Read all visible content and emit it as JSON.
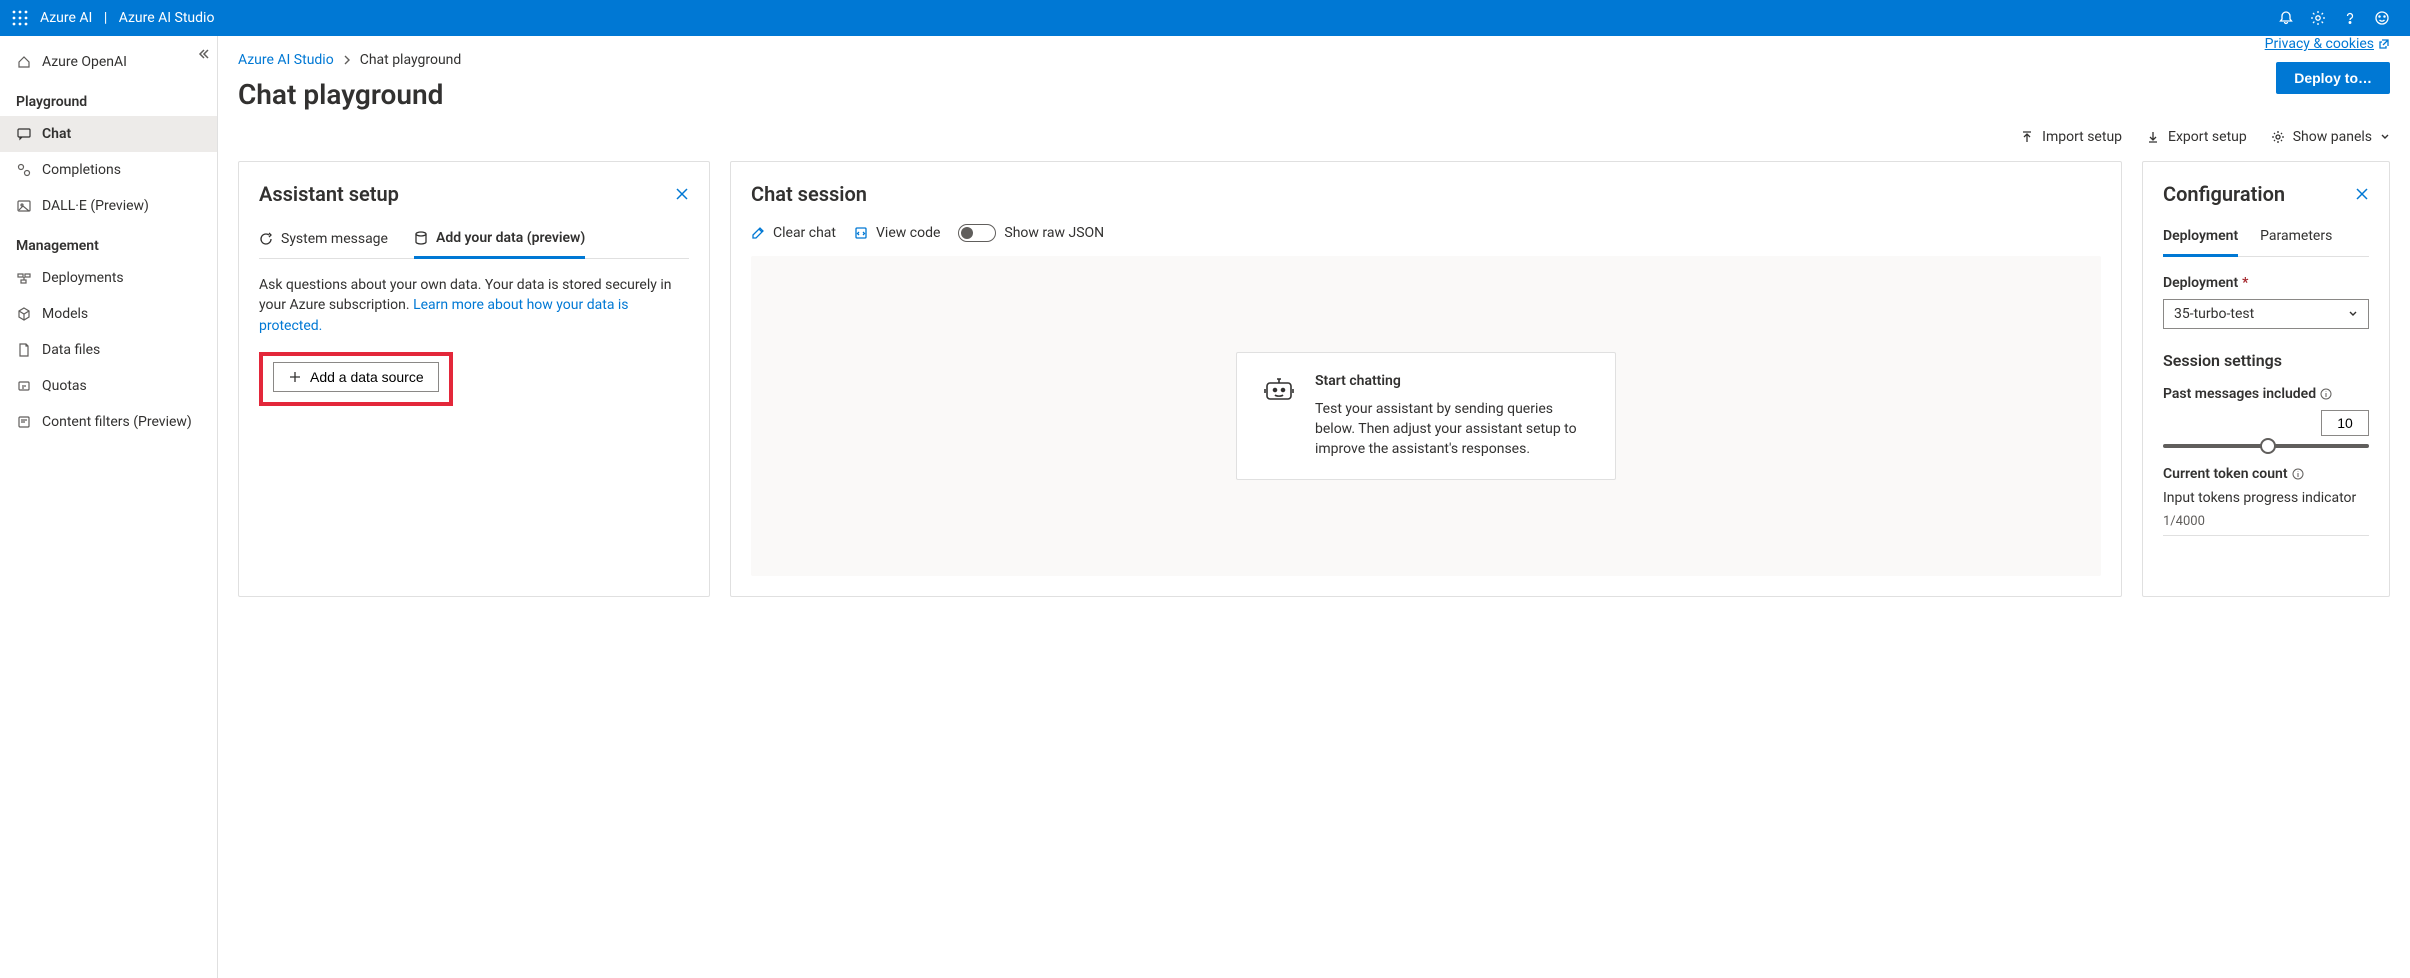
{
  "topbar": {
    "brand1": "Azure AI",
    "brand2": "Azure AI Studio"
  },
  "sidebar": {
    "items": [
      {
        "label": "Azure OpenAI"
      }
    ],
    "section_playground": "Playground",
    "playground_items": [
      {
        "label": "Chat"
      },
      {
        "label": "Completions"
      },
      {
        "label": "DALL·E (Preview)"
      }
    ],
    "section_management": "Management",
    "management_items": [
      {
        "label": "Deployments"
      },
      {
        "label": "Models"
      },
      {
        "label": "Data files"
      },
      {
        "label": "Quotas"
      },
      {
        "label": "Content filters (Preview)"
      }
    ]
  },
  "breadcrumb": {
    "root": "Azure AI Studio",
    "leaf": "Chat playground"
  },
  "page": {
    "title": "Chat playground",
    "privacy": "Privacy & cookies",
    "deploy": "Deploy to…",
    "import": "Import setup",
    "export": "Export setup",
    "show_panels": "Show panels"
  },
  "assistant": {
    "title": "Assistant setup",
    "tab_system": "System message",
    "tab_data": "Add your data (preview)",
    "desc1": "Ask questions about your own data. Your data is stored securely in your Azure subscription. ",
    "link": "Learn more about how your data is protected.",
    "add_ds": "Add a data source"
  },
  "chat": {
    "title": "Chat session",
    "clear": "Clear chat",
    "view_code": "View code",
    "raw_json": "Show raw JSON",
    "start_title": "Start chatting",
    "start_body": "Test your assistant by sending queries below. Then adjust your assistant setup to improve the assistant's responses."
  },
  "config": {
    "title": "Configuration",
    "tab_deployment": "Deployment",
    "tab_parameters": "Parameters",
    "deployment_label": "Deployment",
    "deployment_value": "35-turbo-test",
    "session_title": "Session settings",
    "past_msgs": "Past messages included",
    "past_msgs_value": "10",
    "token_count_label": "Current token count",
    "token_prog_label": "Input tokens progress indicator",
    "token_val": "1/4000"
  }
}
